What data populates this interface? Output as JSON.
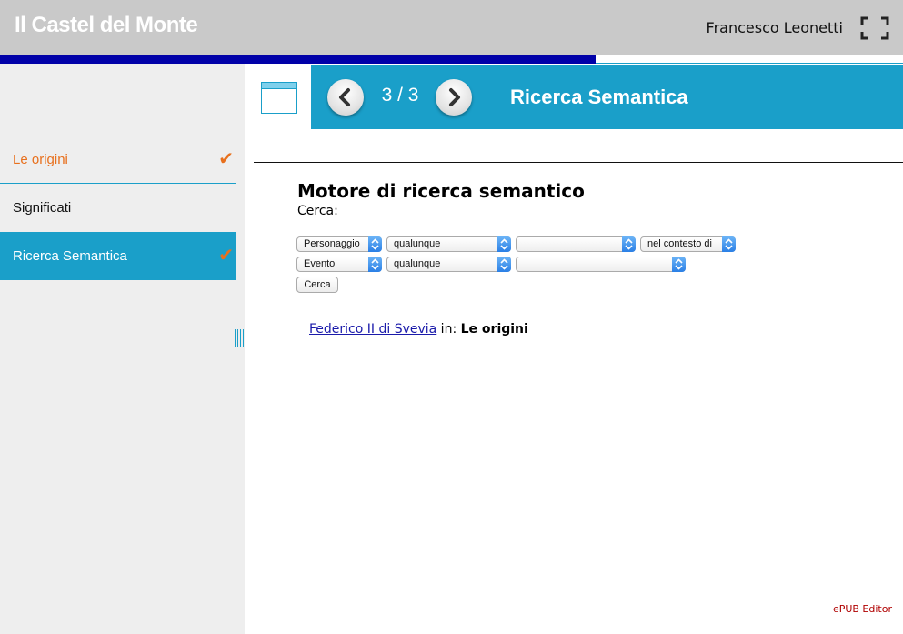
{
  "header": {
    "title": "Il Castel del Monte",
    "user": "Francesco Leonetti",
    "fullscreen_icon": "fullscreen-icon"
  },
  "progress": {
    "fraction": 0.66,
    "color": "#0000a8"
  },
  "sidebar": {
    "items": [
      {
        "label": "Le origini",
        "state": "visited",
        "checked": true
      },
      {
        "label": "Significati",
        "state": "normal",
        "checked": false
      },
      {
        "label": "Ricerca Semantica",
        "state": "active",
        "checked": true
      }
    ],
    "check_glyph": "✔"
  },
  "navbar": {
    "page_counter": "3 / 3",
    "section_title": "Ricerca Semantica",
    "prev_icon": "chevron-left-icon",
    "next_icon": "chevron-right-icon",
    "toc_icon": "window-icon"
  },
  "main": {
    "heading": "Motore di ricerca semantico",
    "search_label": "Cerca:",
    "row1": {
      "type": "Personaggio",
      "value": "qualunque",
      "relation": "",
      "context": "nel contesto di"
    },
    "row2": {
      "type": "Evento",
      "value": "qualunque",
      "relation": ""
    },
    "search_button": "Cerca",
    "result": {
      "link": "Federico II di Svevia",
      "middle": " in: ",
      "location": "Le origini"
    }
  },
  "footer": {
    "label": "ePUB Editor"
  },
  "colors": {
    "accent": "#1a9fc9",
    "visited": "#e8701d",
    "header_bg": "#c9c9c9",
    "footer_text": "#b00000"
  }
}
